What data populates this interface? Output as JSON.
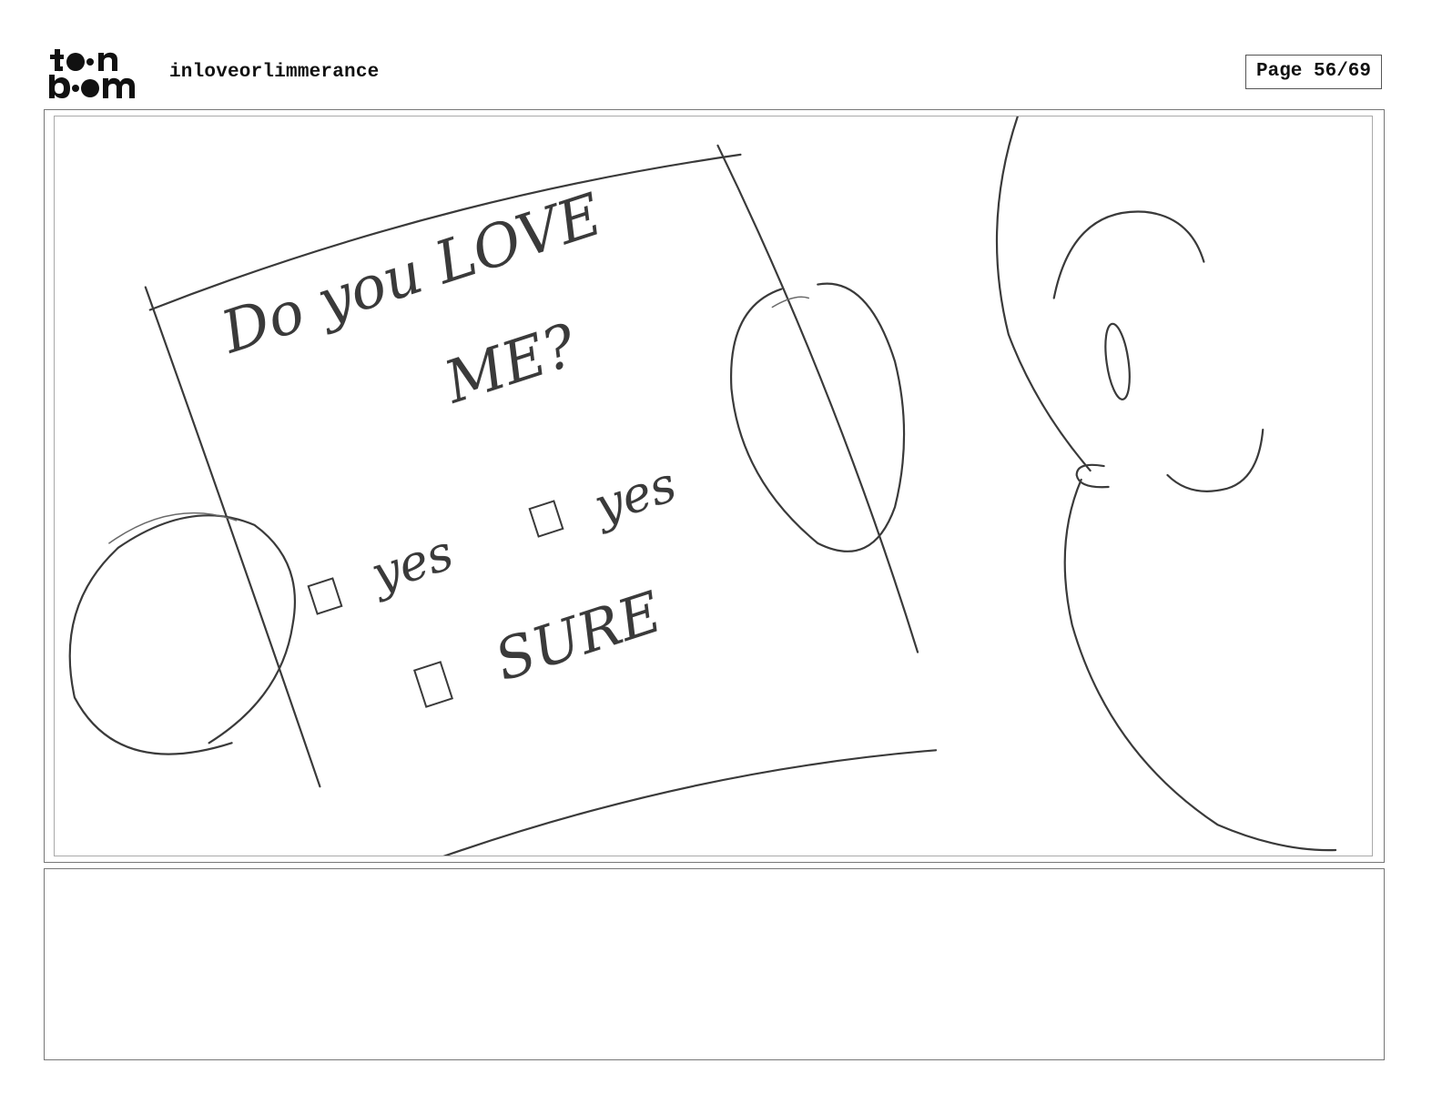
{
  "header": {
    "logo_name": "toon boom",
    "project_title": "inloveorlimmerance",
    "page_indicator": "Page 56/69"
  },
  "panel": {
    "sketch_text": {
      "line1": "Do you LOVE",
      "line2": "ME?",
      "option1": "yes",
      "option2": "yes",
      "option3": "SURE"
    }
  },
  "notes": {
    "text": ""
  }
}
